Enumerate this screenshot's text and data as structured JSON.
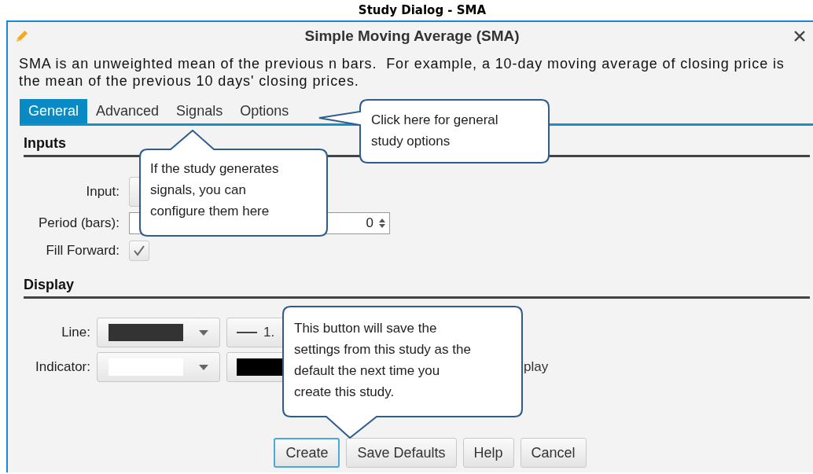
{
  "page_title": "Study Dialog - SMA",
  "dialog": {
    "title": "Simple Moving Average (SMA)",
    "description": "SMA is an unweighted mean of the previous n bars.  For example, a 10-day moving average of closing price is the mean of the previous 10 days' closing prices.",
    "tabs": [
      {
        "label": "General",
        "selected": true
      },
      {
        "label": "Advanced",
        "selected": false
      },
      {
        "label": "Signals",
        "selected": false
      },
      {
        "label": "Options",
        "selected": false
      }
    ],
    "inputs": {
      "heading": "Inputs",
      "rows": [
        {
          "kind": "dropdown",
          "label": "Input:"
        },
        {
          "kind": "spin_pair",
          "label": "Period (bars):",
          "second_field_value": "0"
        },
        {
          "kind": "checkbox",
          "label": "Fill Forward:",
          "checked": true
        }
      ]
    },
    "display": {
      "heading": "Display",
      "rows": [
        {
          "label": "Line:",
          "swatch": {
            "color": "#333333"
          },
          "button": {
            "kind": "line_width",
            "text": "1."
          }
        },
        {
          "label": "Indicator:",
          "swatch": {
            "color": "#ffffff"
          },
          "button": {
            "kind": "swatch",
            "color": "#000000"
          },
          "trailing_text": "play"
        }
      ]
    },
    "buttons": [
      {
        "label": "Create",
        "focused": true
      },
      {
        "label": "Save Defaults",
        "focused": false
      },
      {
        "label": "Help",
        "focused": false
      },
      {
        "label": "Cancel",
        "focused": false
      }
    ]
  },
  "callouts": [
    {
      "kind": "left",
      "text": "Click here for general study options"
    },
    {
      "kind": "up",
      "text": "If the study generates signals, you can configure them here"
    },
    {
      "kind": "down",
      "text": "This button will save the settings from this study as the default the next time you create this study."
    }
  ]
}
